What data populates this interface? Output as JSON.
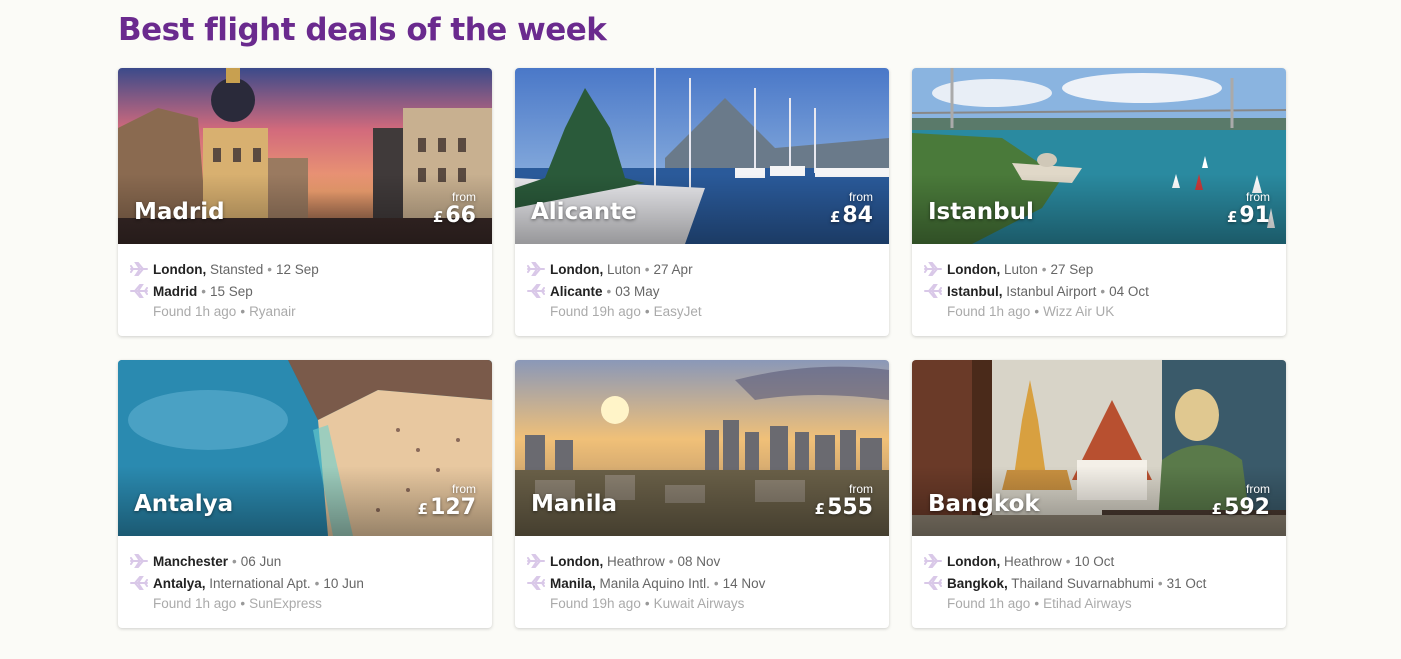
{
  "page": {
    "title": "Best flight deals of the week"
  },
  "colors": {
    "title": "#6a2a8e",
    "plane_icon": "#d9c8e8"
  },
  "deals": [
    {
      "city": "Madrid",
      "from_label": "from",
      "currency": "£",
      "price": "66",
      "outbound": {
        "city": "London,",
        "airport": "Stansted",
        "date": "12 Sep"
      },
      "inbound": {
        "city": "Madrid",
        "airport": "",
        "date": "15 Sep"
      },
      "found": "Found 1h ago",
      "airline": "Ryanair",
      "photo": "madrid-street-sunset"
    },
    {
      "city": "Alicante",
      "from_label": "from",
      "currency": "£",
      "price": "84",
      "outbound": {
        "city": "London,",
        "airport": "Luton",
        "date": "27 Apr"
      },
      "inbound": {
        "city": "Alicante",
        "airport": "",
        "date": "03 May"
      },
      "found": "Found 19h ago",
      "airline": "EasyJet",
      "photo": "alicante-marina"
    },
    {
      "city": "Istanbul",
      "from_label": "from",
      "currency": "£",
      "price": "91",
      "outbound": {
        "city": "London,",
        "airport": "Luton",
        "date": "27 Sep"
      },
      "inbound": {
        "city": "Istanbul,",
        "airport": "Istanbul Airport",
        "date": "04 Oct"
      },
      "found": "Found 1h ago",
      "airline": "Wizz Air UK",
      "photo": "istanbul-bosphorus"
    },
    {
      "city": "Antalya",
      "from_label": "from",
      "currency": "£",
      "price": "127",
      "outbound": {
        "city": "Manchester",
        "airport": "",
        "date": "06 Jun"
      },
      "inbound": {
        "city": "Antalya,",
        "airport": "International Apt.",
        "date": "10 Jun"
      },
      "found": "Found 1h ago",
      "airline": "SunExpress",
      "photo": "antalya-beach"
    },
    {
      "city": "Manila",
      "from_label": "from",
      "currency": "£",
      "price": "555",
      "outbound": {
        "city": "London,",
        "airport": "Heathrow",
        "date": "08 Nov"
      },
      "inbound": {
        "city": "Manila,",
        "airport": "Manila Aquino Intl.",
        "date": "14 Nov"
      },
      "found": "Found 19h ago",
      "airline": "Kuwait Airways",
      "photo": "manila-skyline"
    },
    {
      "city": "Bangkok",
      "from_label": "from",
      "currency": "£",
      "price": "592",
      "outbound": {
        "city": "London,",
        "airport": "Heathrow",
        "date": "10 Oct"
      },
      "inbound": {
        "city": "Bangkok,",
        "airport": "Thailand Suvarnabhumi",
        "date": "31 Oct"
      },
      "found": "Found 1h ago",
      "airline": "Etihad Airways",
      "photo": "bangkok-temple"
    }
  ]
}
